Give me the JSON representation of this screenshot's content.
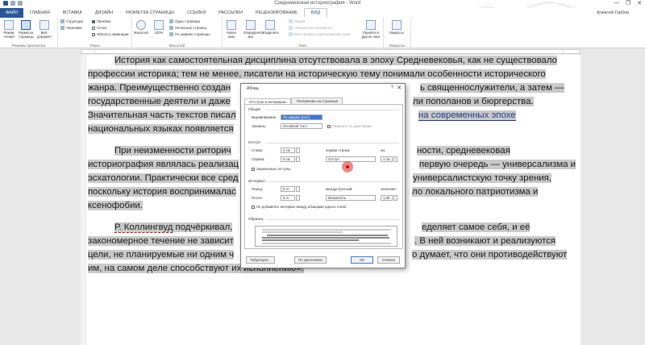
{
  "window": {
    "title": "Средневековая историография - Word",
    "minimize": "—",
    "restore": "❐",
    "close": "✕"
  },
  "ribbon_tabs": [
    {
      "label": "ФАЙЛ"
    },
    {
      "label": "ГЛАВНАЯ"
    },
    {
      "label": "ВСТАВКА"
    },
    {
      "label": "ДИЗАЙН"
    },
    {
      "label": "РАЗМЕТКА СТРАНИЦЫ"
    },
    {
      "label": "ССЫЛКИ"
    },
    {
      "label": "РАССЫЛКИ"
    },
    {
      "label": "РЕЦЕНЗИРОВАНИЕ"
    },
    {
      "label": "ВИД"
    }
  ],
  "user_name": "Алексей Горбов",
  "ribbon": {
    "modes_group": "Режимы просмотра",
    "show_group": "Показ",
    "zoom_group": "Масштаб",
    "window_group": "Окно",
    "macros_group": "Макросы",
    "read_mode": "Режим чтения",
    "print_layout": "Разметка страницы",
    "web_layout": "Веб-документ",
    "outline": "Структура",
    "draft": "Черновик",
    "ruler": "Линейка",
    "grid": "Сетка",
    "nav_pane": "Область навигации",
    "zoom": "Масштаб",
    "zoom_100": "100%",
    "one_page": "Одна страница",
    "multiple_pages": "Несколько страниц",
    "page_width": "По ширине страницы",
    "new_window": "Новое окно",
    "arrange_all": "Упорядочить все",
    "split": "Разделить",
    "side_by_side": "Рядом",
    "sync_scroll": "Синхронная прокрутка",
    "reset_position": "Восстановить расположение окна",
    "switch_windows": "Перейти в другое окно",
    "macros": "Макросы"
  },
  "document": {
    "lines": [
      "История как самостоятельная дисциплина отсутствовала в эпоху Средневековья, как не существовало",
      "профессии историка; тем не менее, писатели на историческую тему понимали особенности исторического",
      "жанра. Преимущественно создан",
      "ь священнослужители, а затем —",
      "государственные деятели и даже",
      "ли пополанов и бюргерства.",
      "Значительная часть текстов писал",
      "на современных эпохе",
      "национальных языках появляется",
      "При неизменности риторич",
      "ности, средневековая",
      "историография являлась реализац",
      "первую очередь — универсализма и",
      "эсхатологии. Практически все сред",
      "универсалистскую точку зрения,",
      "поскольку история воспринималас",
      "ло локального патриотизма и",
      "ксенофобии.",
      "Р. Коллингвуд",
      " подчёркивал,",
      "еделяет самое себя, и её",
      "закономерное течение не зависит",
      ". В ней возникают и реализуются",
      "цели, не планируемые ни одним ч",
      "о думает, что они противодействуют",
      "им, на самом деле способствуют их исполнению»."
    ]
  },
  "dialog": {
    "title": "Абзац",
    "help": "?",
    "close": "✕",
    "tab_indents": "Отступы и интервалы",
    "tab_page": "Положение на странице",
    "general": "Общие",
    "alignment_label": "Выравнивание:",
    "alignment_value": "По ширине (гост)",
    "level_label": "Уровень:",
    "level_value": "Основной текст",
    "collapsed": "Свернуто по умолчанию",
    "indent": "Отступ",
    "left_label": "Слева:",
    "left_value": "0 см",
    "right_label": "Справа:",
    "right_value": "0 см",
    "first_line_label": "первая строка:",
    "first_line_value": "Отступ",
    "by_label": "на:",
    "by_value": "1 см",
    "mirror": "Зеркальные отступы",
    "spacing": "Интервал",
    "before_label": "Перед:",
    "before_value": "0 пт",
    "after_label": "После:",
    "after_value": "8 пт",
    "line_spacing_label": "междустрочный:",
    "line_spacing_value": "Множитель",
    "at_label": "значение:",
    "at_value": "1,08",
    "no_space": "Не добавлять интервал между абзацами одного стиля",
    "preview": "Образец",
    "btn_tabs": "Табуляция...",
    "btn_default": "По умолчанию",
    "btn_ok": "ОК",
    "btn_cancel": "Отмена"
  }
}
